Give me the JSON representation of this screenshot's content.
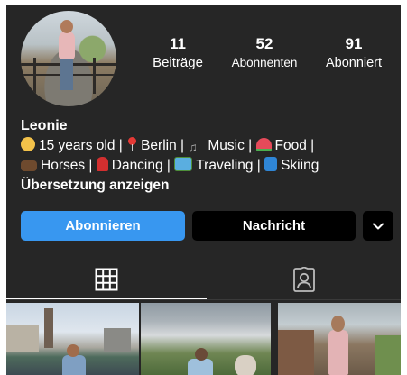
{
  "profile": {
    "stats": [
      {
        "count": "11",
        "label": "Beiträge"
      },
      {
        "count": "52",
        "label": "Abonnenten"
      },
      {
        "count": "91",
        "label": "Abonniert"
      }
    ],
    "name": "Leonie",
    "bio": {
      "age": "15 years old |",
      "city": "Berlin |",
      "music": "Music |",
      "food": "Food |",
      "horses": "Horses |",
      "dancing": "Dancing |",
      "traveling": "Traveling |",
      "skiing": "Skiing"
    },
    "translate_label": "Übersetzung anzeigen"
  },
  "actions": {
    "follow_label": "Abonnieren",
    "message_label": "Nachricht",
    "more_icon": "chevron-down-icon"
  },
  "tabs": [
    {
      "icon": "grid-icon",
      "active": true
    },
    {
      "icon": "tagged-person-icon",
      "active": false
    }
  ],
  "colors": {
    "background": "#262626",
    "follow_button": "#3897f0",
    "message_button": "#000000",
    "text": "#ffffff"
  }
}
